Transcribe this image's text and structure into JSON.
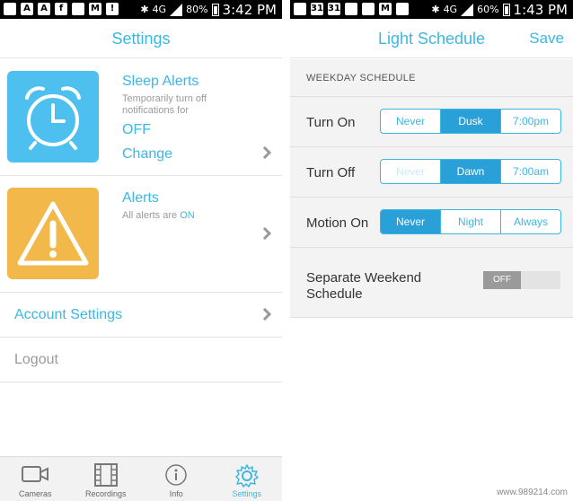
{
  "colors": {
    "accent": "#3eb6e2",
    "tile_blue": "#4ec0ef",
    "tile_orange": "#f2b849",
    "selected": "#2aa0d8"
  },
  "left_screen": {
    "status_bar": {
      "battery": "80%",
      "time": "3:42 PM",
      "network": "4G"
    },
    "title": "Settings",
    "sleep_alerts": {
      "icon": "alarm-clock-icon",
      "title": "Sleep Alerts",
      "description": "Temporarily turn off notifications for",
      "value": "OFF",
      "action": "Change"
    },
    "alerts": {
      "icon": "warning-icon",
      "title": "Alerts",
      "description_prefix": "All alerts are",
      "status": "ON"
    },
    "account_settings_label": "Account Settings",
    "logout_label": "Logout",
    "bottom_nav": [
      {
        "label": "Cameras",
        "icon": "camera-icon"
      },
      {
        "label": "Recordings",
        "icon": "film-icon"
      },
      {
        "label": "Info",
        "icon": "info-icon"
      },
      {
        "label": "Settings",
        "icon": "gear-icon",
        "active": true
      }
    ]
  },
  "right_screen": {
    "status_bar": {
      "battery": "60%",
      "time": "1:43 PM",
      "network": "4G"
    },
    "title": "Light Schedule",
    "save_label": "Save",
    "section_header": "WEEKDAY SCHEDULE",
    "rows": [
      {
        "label": "Turn On",
        "options": [
          "Never",
          "Dusk",
          "7:00pm"
        ],
        "selected": "Dusk"
      },
      {
        "label": "Turn Off",
        "options": [
          "Never",
          "Dawn",
          "7:00am"
        ],
        "selected": "Dawn",
        "disabled": "Never"
      },
      {
        "label": "Motion On",
        "options": [
          "Never",
          "Night",
          "Always"
        ],
        "selected": "Never"
      }
    ],
    "weekend": {
      "label": "Separate Weekend Schedule",
      "toggle_value": "OFF"
    }
  },
  "watermark": "www.989214.com"
}
